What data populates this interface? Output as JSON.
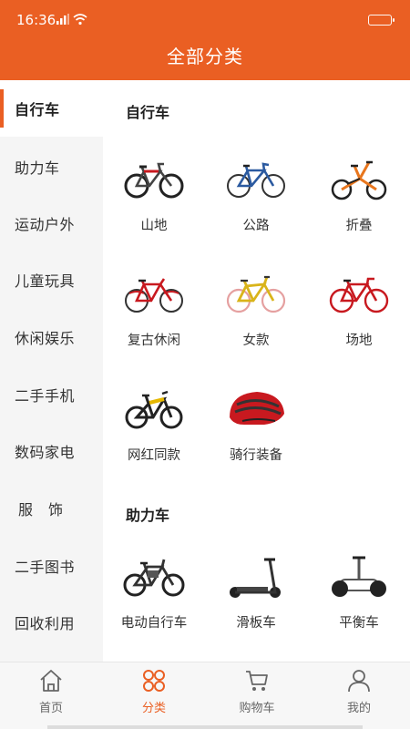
{
  "status_bar": {
    "time": "16:36"
  },
  "header": {
    "title": "全部分类"
  },
  "colors": {
    "accent": "#ea5f23",
    "helmet": "#c8191f"
  },
  "sidebar": {
    "items": [
      {
        "label": "自行车",
        "active": true
      },
      {
        "label": "助力车"
      },
      {
        "label": "运动户外"
      },
      {
        "label": "儿童玩具"
      },
      {
        "label": "休闲娱乐"
      },
      {
        "label": "二手手机"
      },
      {
        "label": "数码家电"
      },
      {
        "label": "服　饰"
      },
      {
        "label": "二手图书"
      },
      {
        "label": "回收利用"
      }
    ]
  },
  "sections": [
    {
      "title": "自行车",
      "items": [
        {
          "label": "山地",
          "icon": "mountain-bike-icon"
        },
        {
          "label": "公路",
          "icon": "road-bike-icon"
        },
        {
          "label": "折叠",
          "icon": "folding-bike-icon"
        },
        {
          "label": "复古休闲",
          "icon": "retro-bike-icon"
        },
        {
          "label": "女款",
          "icon": "womens-bike-icon"
        },
        {
          "label": "场地",
          "icon": "track-bike-icon"
        },
        {
          "label": "网红同款",
          "icon": "trendy-bike-icon"
        },
        {
          "label": "骑行装备",
          "icon": "helmet-icon"
        }
      ]
    },
    {
      "title": "助力车",
      "items": [
        {
          "label": "电动自行车",
          "icon": "ebike-icon"
        },
        {
          "label": "滑板车",
          "icon": "scooter-icon"
        },
        {
          "label": "平衡车",
          "icon": "balance-scooter-icon"
        }
      ]
    }
  ],
  "tabbar": {
    "tabs": [
      {
        "label": "首页",
        "icon": "home-icon"
      },
      {
        "label": "分类",
        "icon": "category-icon",
        "active": true
      },
      {
        "label": "购物车",
        "icon": "cart-icon"
      },
      {
        "label": "我的",
        "icon": "profile-icon"
      }
    ]
  }
}
